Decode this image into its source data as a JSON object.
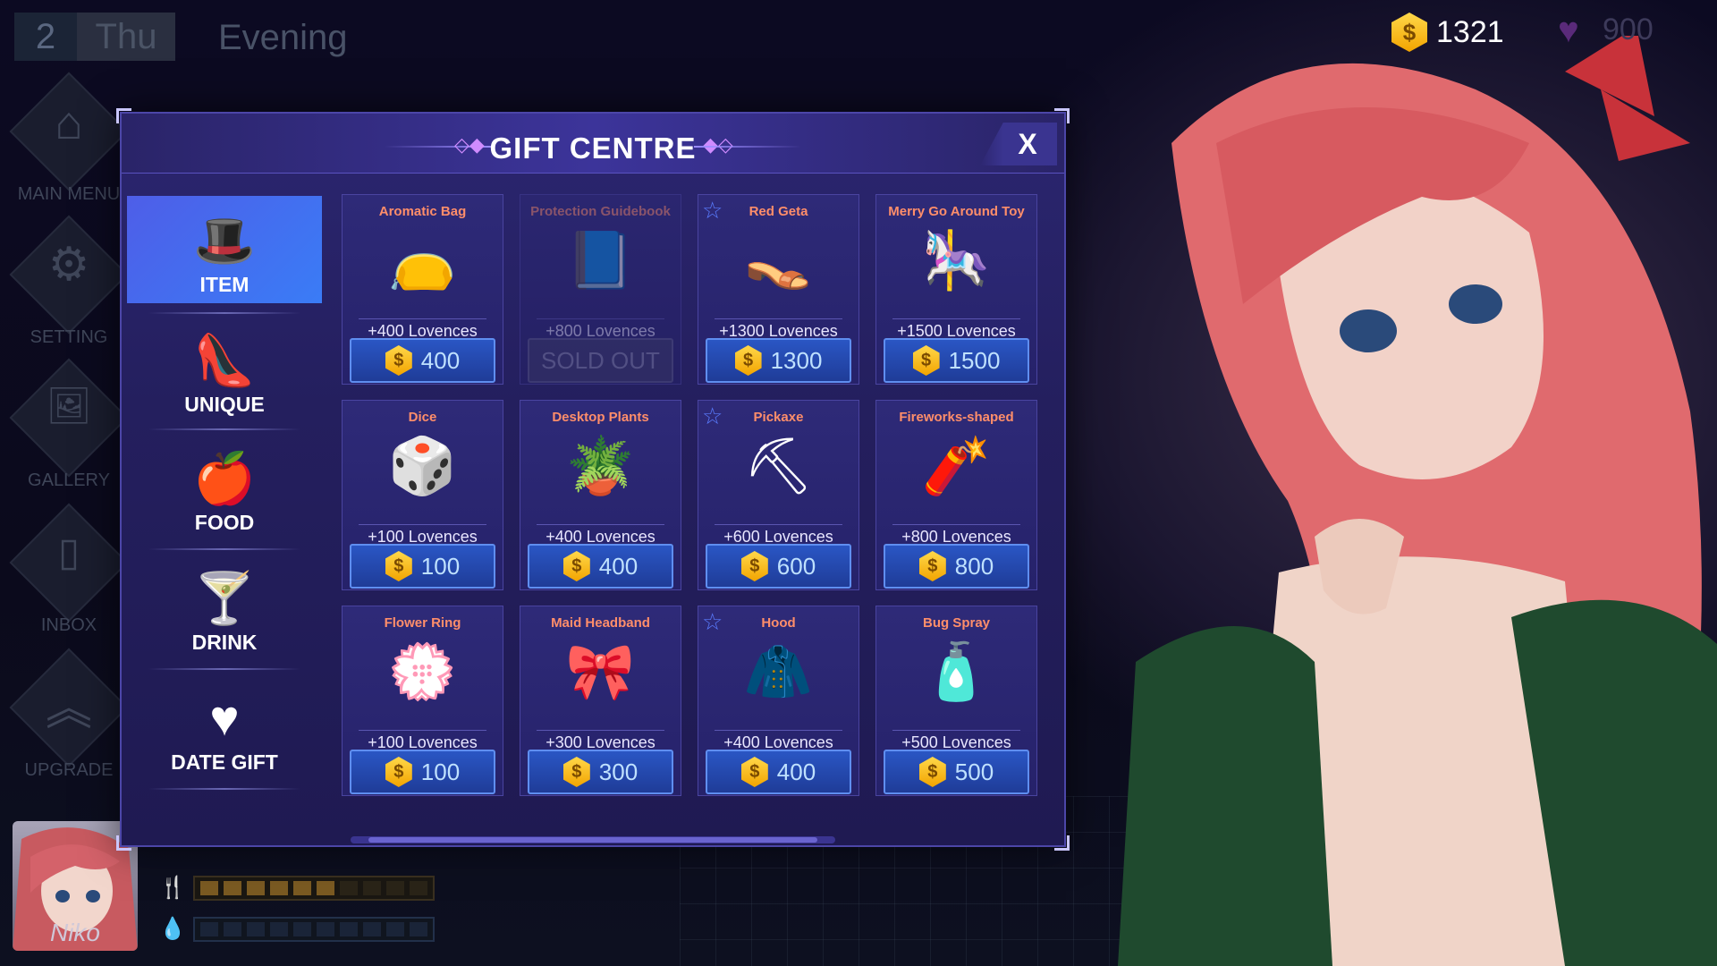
{
  "status": {
    "day_number": "2",
    "day_name": "Thu",
    "time_of_day": "Evening",
    "gold": "1321",
    "hearts": "900"
  },
  "sidebar": {
    "items": [
      {
        "label": "MAIN MENU",
        "icon": "home-icon"
      },
      {
        "label": "SETTING",
        "icon": "gear-icon"
      },
      {
        "label": "GALLERY",
        "icon": "image-icon"
      },
      {
        "label": "INBOX",
        "icon": "phone-icon"
      },
      {
        "label": "UPGRADE",
        "icon": "chevron-up-icon"
      }
    ]
  },
  "character": {
    "name": "Niko"
  },
  "gift_centre": {
    "title": "GIFT CENTRE",
    "close_label": "X",
    "categories": [
      {
        "label": "ITEM",
        "icon": "hat-icon"
      },
      {
        "label": "UNIQUE",
        "icon": "shoe-icon"
      },
      {
        "label": "FOOD",
        "icon": "apple-icon"
      },
      {
        "label": "DRINK",
        "icon": "cocktail-icon"
      },
      {
        "label": "DATE GIFT",
        "icon": "heart-icon"
      }
    ],
    "active_category": "ITEM",
    "items": [
      {
        "name": "Aromatic Bag",
        "lovences": "+400 Lovences",
        "price": "400",
        "starred": false,
        "sold_out": false,
        "icon": "bag-icon"
      },
      {
        "name": "Protection Guidebook",
        "lovences": "+800 Lovences",
        "price": "SOLD OUT",
        "starred": false,
        "sold_out": true,
        "icon": "book-icon"
      },
      {
        "name": "Red Geta",
        "lovences": "+1300 Lovences",
        "price": "1300",
        "starred": true,
        "sold_out": false,
        "icon": "sandal-icon"
      },
      {
        "name": "Merry Go Around Toy",
        "lovences": "+1500 Lovences",
        "price": "1500",
        "starred": false,
        "sold_out": false,
        "icon": "carousel-icon"
      },
      {
        "name": "Dice",
        "lovences": "+100 Lovences",
        "price": "100",
        "starred": false,
        "sold_out": false,
        "icon": "dice-icon"
      },
      {
        "name": "Desktop Plants",
        "lovences": "+400 Lovences",
        "price": "400",
        "starred": false,
        "sold_out": false,
        "icon": "plant-icon"
      },
      {
        "name": "Pickaxe",
        "lovences": "+600 Lovences",
        "price": "600",
        "starred": true,
        "sold_out": false,
        "icon": "pickaxe-icon"
      },
      {
        "name": "Fireworks-shaped",
        "lovences": "+800 Lovences",
        "price": "800",
        "starred": false,
        "sold_out": false,
        "icon": "firework-icon"
      },
      {
        "name": "Flower Ring",
        "lovences": "+100 Lovences",
        "price": "100",
        "starred": false,
        "sold_out": false,
        "icon": "wreath-icon"
      },
      {
        "name": "Maid Headband",
        "lovences": "+300 Lovences",
        "price": "300",
        "starred": false,
        "sold_out": false,
        "icon": "headband-icon"
      },
      {
        "name": "Hood",
        "lovences": "+400 Lovences",
        "price": "400",
        "starred": true,
        "sold_out": false,
        "icon": "hood-icon"
      },
      {
        "name": "Bug Spray",
        "lovences": "+500 Lovences",
        "price": "500",
        "starred": false,
        "sold_out": false,
        "icon": "spray-icon"
      }
    ]
  },
  "colors": {
    "accent": "#3a7cf6",
    "item_name": "#ff8e6a",
    "price_text": "#bfe1ff",
    "gold": "#f2a400"
  }
}
